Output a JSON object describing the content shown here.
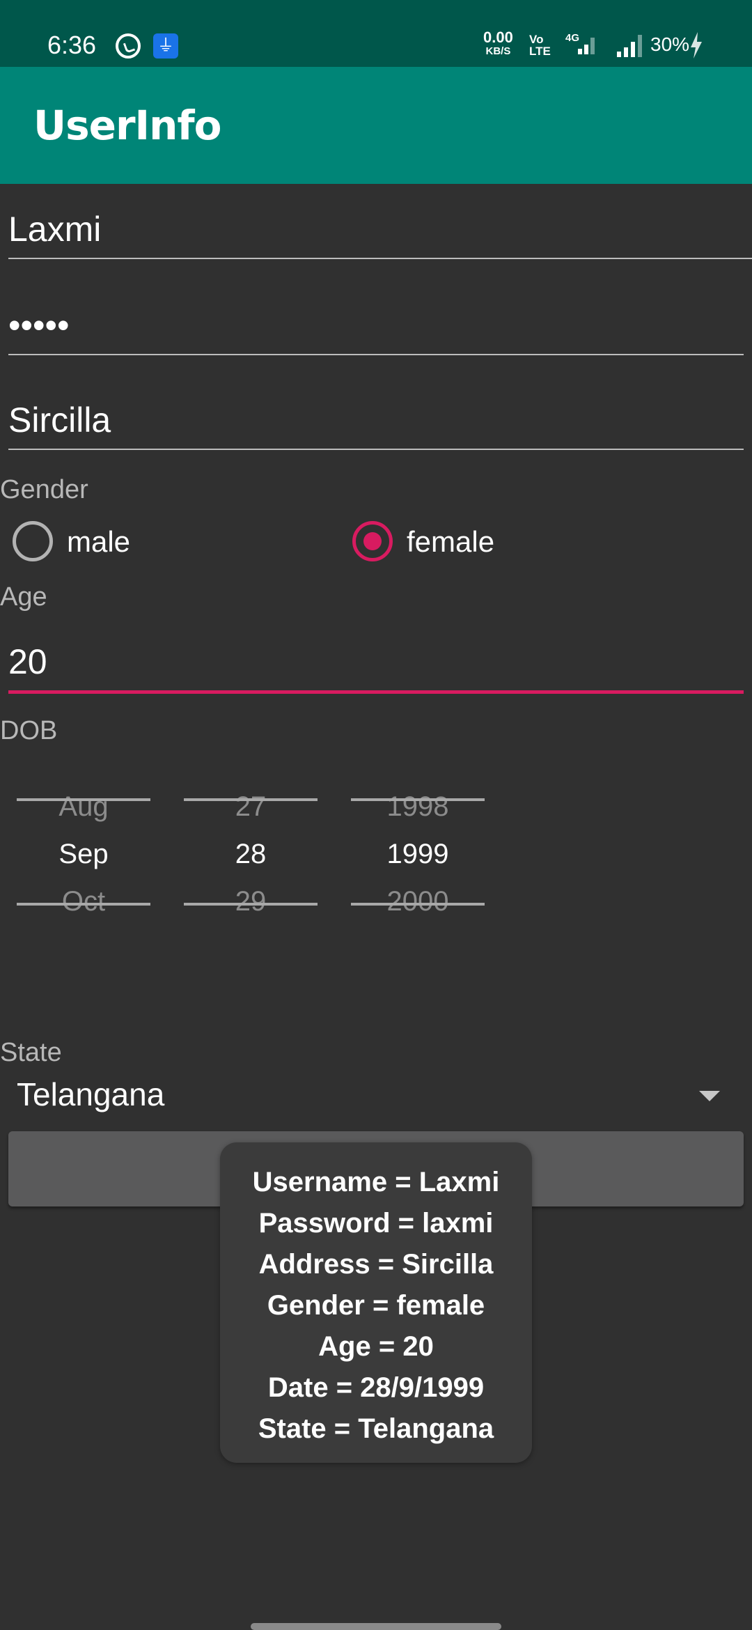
{
  "status_bar": {
    "time": "6:36",
    "net_speed": "0.00",
    "net_speed_unit": "KB/S",
    "volte": "Vo",
    "volte_sub": "LTE",
    "network_type": "4G",
    "battery": "30%",
    "icons": [
      "whatsapp-icon",
      "usb-icon",
      "signal-icon",
      "charging-icon"
    ]
  },
  "app_bar": {
    "title": "UserInfo"
  },
  "form": {
    "username": "Laxmi",
    "password_masked": "•••••",
    "address": "Sircilla",
    "gender_label": "Gender",
    "gender_options": [
      {
        "label": "male",
        "selected": false
      },
      {
        "label": "female",
        "selected": true
      }
    ],
    "age_label": "Age",
    "age": "20",
    "dob_label": "DOB",
    "dob": {
      "month": {
        "prev": "Aug",
        "current": "Sep",
        "next": "Oct"
      },
      "day": {
        "prev": "27",
        "current": "28",
        "next": "29"
      },
      "year": {
        "prev": "1998",
        "current": "1999",
        "next": "2000"
      }
    },
    "state_label": "State",
    "state": "Telangana"
  },
  "toast": {
    "lines": [
      "Username = Laxmi",
      "Password = laxmi",
      "Address = Sircilla",
      "Gender = female",
      "Age = 20",
      "Date = 28/9/1999",
      "State = Telangana"
    ]
  },
  "colors": {
    "status_bar": "#00574b",
    "app_bar": "#008577",
    "accent": "#d81b60",
    "background": "#303030"
  }
}
